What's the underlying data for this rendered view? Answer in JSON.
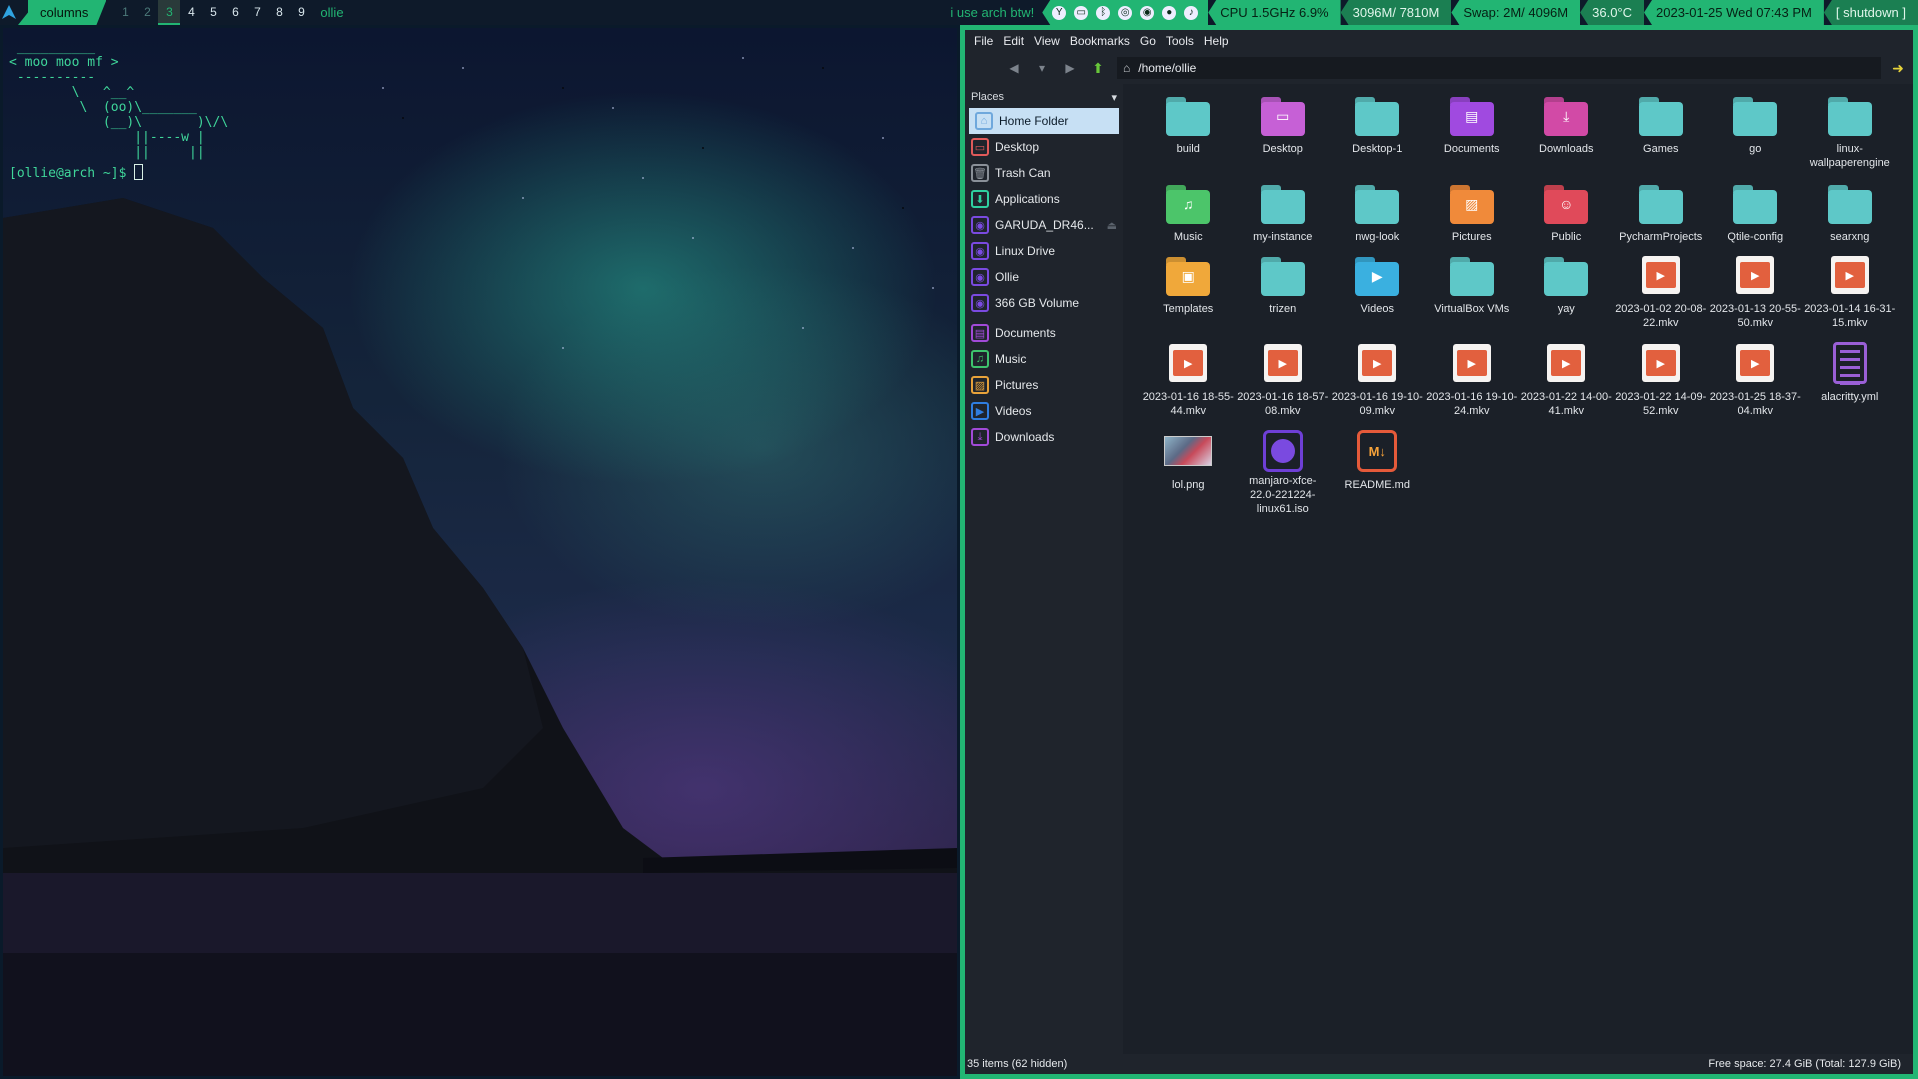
{
  "bar": {
    "layout": "columns",
    "workspaces": [
      "1",
      "2",
      "3",
      "4",
      "5",
      "6",
      "7",
      "8",
      "9"
    ],
    "current_workspace": "3",
    "window_name": "ollie",
    "motto": "i use arch btw!",
    "cpu": "CPU 1.5GHz 6.9%",
    "memory": "3096M/ 7810M",
    "swap": "Swap:  2M/ 4096M",
    "temp": "36.0°C",
    "clock": "2023-01-25 Wed 07:43 PM",
    "shutdown": "[ shutdown ]"
  },
  "terminal": {
    "lines": [
      " __________",
      "< moo moo mf >",
      " ----------",
      "        \\   ^__^",
      "         \\  (oo)\\_______",
      "            (__)\\       )\\/\\",
      "                ||----w |",
      "                ||     ||"
    ],
    "prompt": "[ollie@arch ~]$ "
  },
  "fm": {
    "menu": [
      "File",
      "Edit",
      "View",
      "Bookmarks",
      "Go",
      "Tools",
      "Help"
    ],
    "path": "/home/ollie",
    "places_label": "Places",
    "places": [
      {
        "label": "Home Folder",
        "icon": "home-icon",
        "color": "#6fa8dc"
      },
      {
        "label": "Desktop",
        "icon": "desktop-icon",
        "color": "#e05a5a"
      },
      {
        "label": "Trash Can",
        "icon": "trash-icon",
        "color": "#8a9098"
      },
      {
        "label": "Applications",
        "icon": "applications-icon",
        "color": "#2fd0a0"
      },
      {
        "label": "GARUDA_DR46...",
        "icon": "drive-icon",
        "color": "#7a4ae0",
        "eject": true
      },
      {
        "label": "Linux Drive",
        "icon": "drive-icon",
        "color": "#7a4ae0"
      },
      {
        "label": "Ollie",
        "icon": "drive-icon",
        "color": "#7a4ae0"
      },
      {
        "label": "366 GB Volume",
        "icon": "drive-icon",
        "color": "#7a4ae0"
      },
      {
        "label": "Documents",
        "icon": "documents-icon",
        "color": "#a14ad8"
      },
      {
        "label": "Music",
        "icon": "music-icon",
        "color": "#3ec46d"
      },
      {
        "label": "Pictures",
        "icon": "pictures-icon",
        "color": "#e8a23a"
      },
      {
        "label": "Videos",
        "icon": "videos-icon",
        "color": "#2f7de0"
      },
      {
        "label": "Downloads",
        "icon": "downloads-icon",
        "color": "#a14ad8"
      }
    ],
    "items": [
      {
        "label": "build",
        "kind": "folder",
        "color": "#5ec8c8"
      },
      {
        "label": "Desktop",
        "kind": "folder",
        "color": "#c660d6",
        "glyph": "▭"
      },
      {
        "label": "Desktop-1",
        "kind": "folder",
        "color": "#5ec8c8"
      },
      {
        "label": "Documents",
        "kind": "folder",
        "color": "#a04ae0",
        "glyph": "▤"
      },
      {
        "label": "Downloads",
        "kind": "folder",
        "color": "#d24aa6",
        "glyph": "⤓"
      },
      {
        "label": "Games",
        "kind": "folder",
        "color": "#5ec8c8"
      },
      {
        "label": "go",
        "kind": "folder",
        "color": "#5ec8c8"
      },
      {
        "label": "linux-wallpaperengine",
        "kind": "folder",
        "color": "#5ec8c8"
      },
      {
        "label": "Music",
        "kind": "folder",
        "color": "#4cc56a",
        "glyph": "♫",
        "short": true
      },
      {
        "label": "my-instance",
        "kind": "folder",
        "color": "#5ec8c8",
        "short": true
      },
      {
        "label": "nwg-look",
        "kind": "folder",
        "color": "#5ec8c8",
        "short": true
      },
      {
        "label": "Pictures",
        "kind": "folder",
        "color": "#f08a3a",
        "glyph": "▨",
        "short": true
      },
      {
        "label": "Public",
        "kind": "folder",
        "color": "#e04a5a",
        "glyph": "☺",
        "short": true
      },
      {
        "label": "PycharmProjects",
        "kind": "folder",
        "color": "#5ec8c8",
        "short": true
      },
      {
        "label": "Qtile-config",
        "kind": "folder",
        "color": "#5ec8c8",
        "short": true
      },
      {
        "label": "searxng",
        "kind": "folder",
        "color": "#5ec8c8",
        "short": true
      },
      {
        "label": "Templates",
        "kind": "folder",
        "color": "#f0a83a",
        "glyph": "▣"
      },
      {
        "label": "trizen",
        "kind": "folder",
        "color": "#5ec8c8"
      },
      {
        "label": "Videos",
        "kind": "folder",
        "color": "#3ab0e0",
        "glyph": "▶"
      },
      {
        "label": "VirtualBox VMs",
        "kind": "folder",
        "color": "#5ec8c8"
      },
      {
        "label": "yay",
        "kind": "folder",
        "color": "#5ec8c8"
      },
      {
        "label": "2023-01-02 20-08-22.mkv",
        "kind": "video"
      },
      {
        "label": "2023-01-13 20-55-50.mkv",
        "kind": "video"
      },
      {
        "label": "2023-01-14 16-31-15.mkv",
        "kind": "video"
      },
      {
        "label": "2023-01-16 18-55-44.mkv",
        "kind": "video"
      },
      {
        "label": "2023-01-16 18-57-08.mkv",
        "kind": "video"
      },
      {
        "label": "2023-01-16 19-10-09.mkv",
        "kind": "video"
      },
      {
        "label": "2023-01-16 19-10-24.mkv",
        "kind": "video"
      },
      {
        "label": "2023-01-22 14-00-41.mkv",
        "kind": "video"
      },
      {
        "label": "2023-01-22 14-09-52.mkv",
        "kind": "video"
      },
      {
        "label": "2023-01-25 18-37-04.mkv",
        "kind": "video"
      },
      {
        "label": "alacritty.yml",
        "kind": "yml"
      },
      {
        "label": "lol.png",
        "kind": "png"
      },
      {
        "label": "manjaro-xfce-22.0-221224-linux61.iso",
        "kind": "iso"
      },
      {
        "label": "README.md",
        "kind": "md",
        "glyph": "M↓"
      }
    ],
    "status_left": "35 items (62 hidden)",
    "status_right": "Free space: 27.4 GiB (Total: 127.9 GiB)"
  }
}
